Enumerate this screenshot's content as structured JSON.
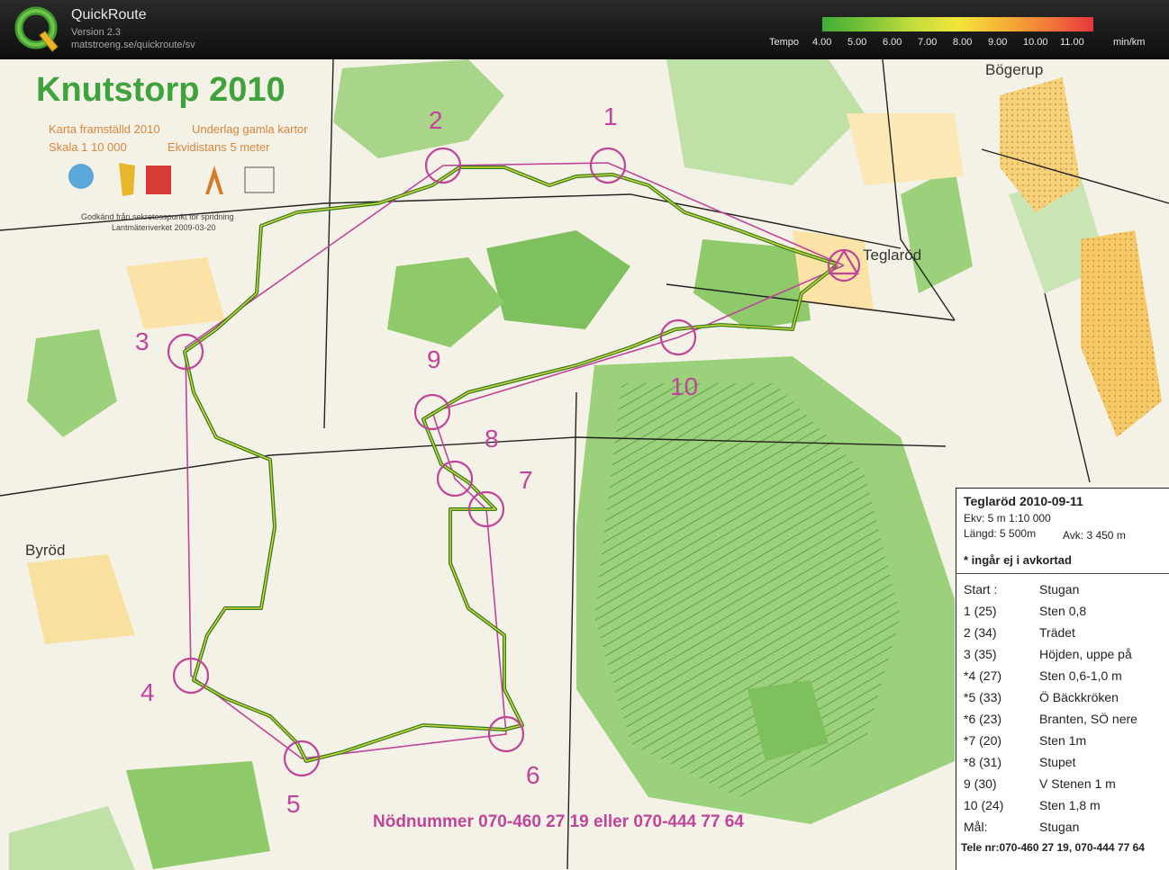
{
  "app": {
    "title": "QuickRoute",
    "version": "Version 2.3",
    "url": "matstroeng.se/quickroute/sv"
  },
  "tempo": {
    "label": "Tempo",
    "ticks": [
      "4.00",
      "5.00",
      "6.00",
      "7.00",
      "8.00",
      "9.00",
      "10.00",
      "11.00"
    ],
    "unit": "min/km",
    "colors": [
      "#3fae35",
      "#7cc437",
      "#c3dc3c",
      "#f2e53a",
      "#f6b235",
      "#f27a3a",
      "#e8363b"
    ]
  },
  "map": {
    "title": "Knutstorp 2010",
    "info_line1_left": "Karta framställd 2010",
    "info_line1_right": "Underlag gamla kartor",
    "info_line2_left": "Skala 1 10 000",
    "info_line2_right": "Ekvidistans 5 meter",
    "approval_line1": "Godkänd från sekretesspunkt för spridning",
    "approval_line2": "Lantmäteriverket 2009-03-20",
    "places": {
      "bogerup": "Bögerup",
      "teglarod": "Teglaröd",
      "byrod": "Byröd"
    },
    "controls": [
      "1",
      "2",
      "3",
      "4",
      "5",
      "6",
      "7",
      "8",
      "9",
      "10"
    ],
    "emergency": "Nödnummer 070-460 27 19 eller 070-444 77 64",
    "colors": {
      "forest": "#8cc96d",
      "open": "#f7d07a",
      "course": "#c0449a",
      "route": "#2e7d1f",
      "title": "#3fa33d"
    }
  },
  "legend": {
    "title": "Teglaröd 2010-09-11",
    "ekv": "Ekv: 5 m  1:10 000",
    "length": "Längd: 5 500m",
    "avk": "Avk: 3 450 m",
    "note": "* ingår ej i avkortad",
    "rows": [
      {
        "code": "Start :",
        "desc": "Stugan"
      },
      {
        "code": "1  (25)",
        "desc": "Sten 0,8"
      },
      {
        "code": "2  (34)",
        "desc": "Trädet"
      },
      {
        "code": "3  (35)",
        "desc": "Höjden, uppe på"
      },
      {
        "code": "*4  (27)",
        "desc": "Sten 0,6-1,0 m"
      },
      {
        "code": "*5  (33)",
        "desc": "Ö Bäckkröken"
      },
      {
        "code": "*6  (23)",
        "desc": "Branten, SÖ nere"
      },
      {
        "code": "*7  (20)",
        "desc": "Sten 1m"
      },
      {
        "code": "*8  (31)",
        "desc": "Stupet"
      },
      {
        "code": "9  (30)",
        "desc": "V Stenen 1 m"
      },
      {
        "code": "10  (24)",
        "desc": "Sten 1,8 m"
      },
      {
        "code": "Mål:",
        "desc": "Stugan"
      }
    ],
    "phone": "Tele nr:070-460 27 19, 070-444 77 64"
  }
}
